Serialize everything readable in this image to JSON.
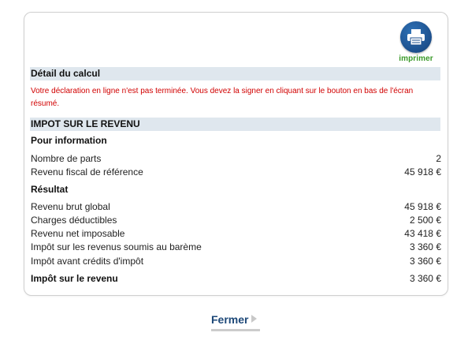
{
  "print_button": {
    "label": "imprimer",
    "icon": "printer-icon"
  },
  "detail": {
    "title": "Détail du calcul",
    "warning": "Votre déclaration en ligne n'est pas terminée. Vous devez la signer en cliquant sur le bouton en bas de l'écran résumé."
  },
  "impot": {
    "title": "IMPOT SUR LE REVENU",
    "info": {
      "title": "Pour information",
      "rows": [
        {
          "label": "Nombre de parts",
          "value": "2"
        },
        {
          "label": "Revenu fiscal de référence",
          "value": "45 918 €"
        }
      ]
    },
    "resultat": {
      "title": "Résultat",
      "rows": [
        {
          "label": "Revenu brut global",
          "value": "45 918 €"
        },
        {
          "label": "Charges déductibles",
          "value": "2 500 €"
        },
        {
          "label": "Revenu net imposable",
          "value": "43 418 €"
        },
        {
          "label": "Impôt sur les revenus soumis au barème",
          "value": "3 360 €"
        },
        {
          "label": "Impôt avant crédits d'impôt",
          "value": "3 360 €"
        }
      ],
      "total": {
        "label": "Impôt sur le revenu",
        "value": "3 360 €"
      }
    }
  },
  "close_button": {
    "label": "Fermer"
  }
}
